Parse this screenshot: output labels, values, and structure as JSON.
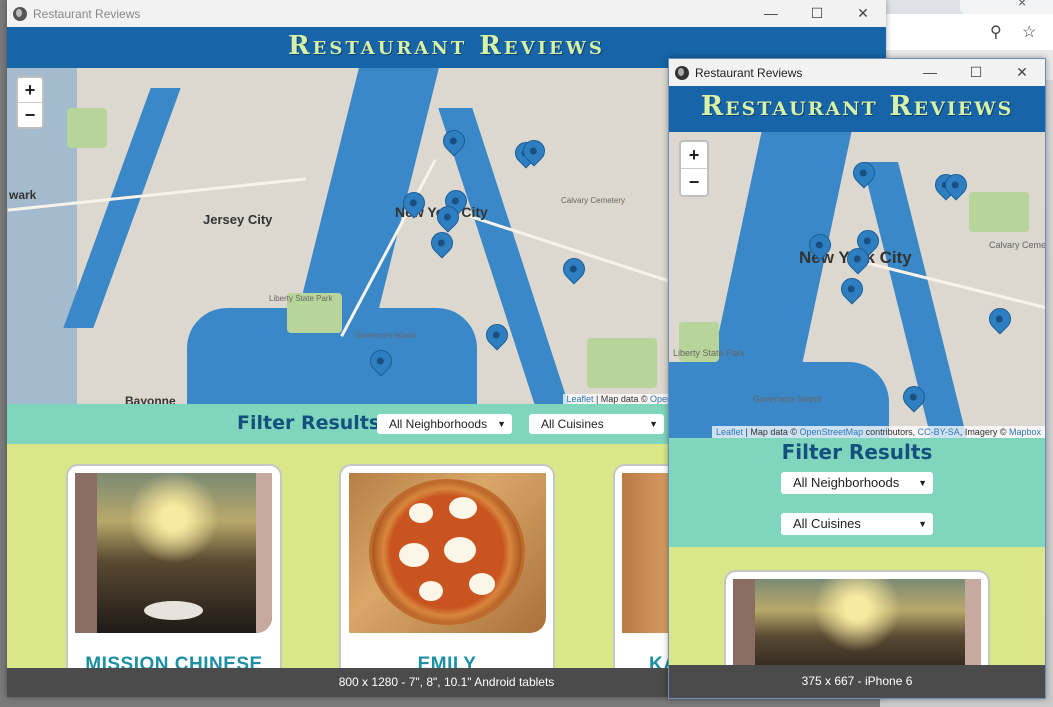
{
  "window_large": {
    "title": "Restaurant Reviews",
    "controls": {
      "minimize": "—",
      "maximize": "☐",
      "close": "✕"
    },
    "site_title": "Restaurant Reviews",
    "map": {
      "zoom_in": "+",
      "zoom_out": "−",
      "labels": {
        "city": "New York City",
        "jersey": "Jersey City",
        "newark": "wark",
        "bayonne": "Bayonne",
        "liberty": "Liberty State Park",
        "governors": "Governors Island",
        "calvary": "Calvary Cemetery"
      },
      "attribution": {
        "leaflet": "Leaflet",
        "text": " | Map data © ",
        "osm": "Open"
      }
    },
    "filter": {
      "title": "Filter Results",
      "neighborhood": "All Neighborhoods",
      "cuisine": "All Cuisines"
    },
    "cards": [
      {
        "name": "MISSION CHINESE"
      },
      {
        "name": "EMILY"
      },
      {
        "name": "KA"
      }
    ],
    "footer": "800 x 1280 - 7\", 8\", 10.1\" Android tablets"
  },
  "window_small": {
    "title": "Restaurant Reviews",
    "controls": {
      "minimize": "—",
      "maximize": "☐",
      "close": "✕"
    },
    "site_title": "Restaurant Reviews",
    "map": {
      "zoom_in": "+",
      "zoom_out": "−",
      "labels": {
        "city": "New York City",
        "calvary": "Calvary Cemetery",
        "governors": "Governors Island",
        "liberty": "Liberty State Park"
      },
      "attribution": {
        "leaflet": "Leaflet",
        "text1": " | Map data © ",
        "osm": "OpenStreetMap",
        "text2": " contributors, ",
        "ccbysa": "CC-BY-SA",
        "text3": ", Imagery © ",
        "mapbox": "Mapbox"
      }
    },
    "filter": {
      "title": "Filter Results",
      "neighborhood": "All Neighborhoods",
      "cuisine": "All Cuisines"
    },
    "footer": "375 x 667 - iPhone 6"
  },
  "background_browser": {
    "tab_close": "×",
    "icons": [
      "zoom-icon",
      "star-icon"
    ]
  },
  "colors": {
    "header_blue": "#1764a9",
    "title_green": "#d7f1a6",
    "filter_teal": "#7fd6bc",
    "content_lime": "#d9e788",
    "card_name": "#1d8fa3",
    "footer_gray": "#4b4b4b",
    "pin_blue": "#2e7fc2"
  }
}
